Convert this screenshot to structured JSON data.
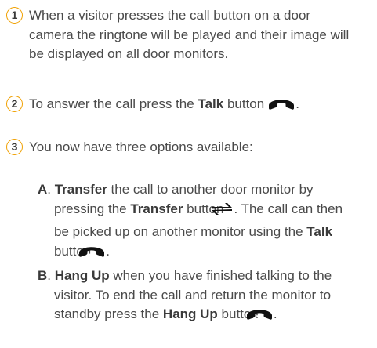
{
  "steps": [
    {
      "num": "1",
      "text": "When a visitor presses the call button on a door camera the ringtone will be played and their image will be displayed on all door monitors."
    },
    {
      "num": "2",
      "text_before": "To answer the call press the ",
      "bold": "Talk",
      "text_after": " button",
      "icon": "phone-answer-icon",
      "end": "."
    },
    {
      "num": "3",
      "text": "You now have three options available:"
    }
  ],
  "options": [
    {
      "letter": "A",
      "sep": ". ",
      "bold1": "Transfer",
      "t1": " the call to another door monitor by pressing the ",
      "bold2": "Transfer",
      "t2": " button",
      "icon1": "transfer-arrows-icon",
      "t3": ". The call can then be picked up on another monitor using the ",
      "bold3": "Talk",
      "t4": " button",
      "icon2": "phone-answer-icon",
      "end": "."
    },
    {
      "letter": "B",
      "sep": ". ",
      "bold1": "Hang Up",
      "t1": " when you have finished talking to the visitor. To end the call and return the monitor to standby press the ",
      "bold2": "Hang Up",
      "t2": " button",
      "icon1": "phone-hangup-icon",
      "end": "."
    }
  ],
  "colors": {
    "badge_border": "#f0a000",
    "text": "#4a4a4a"
  }
}
